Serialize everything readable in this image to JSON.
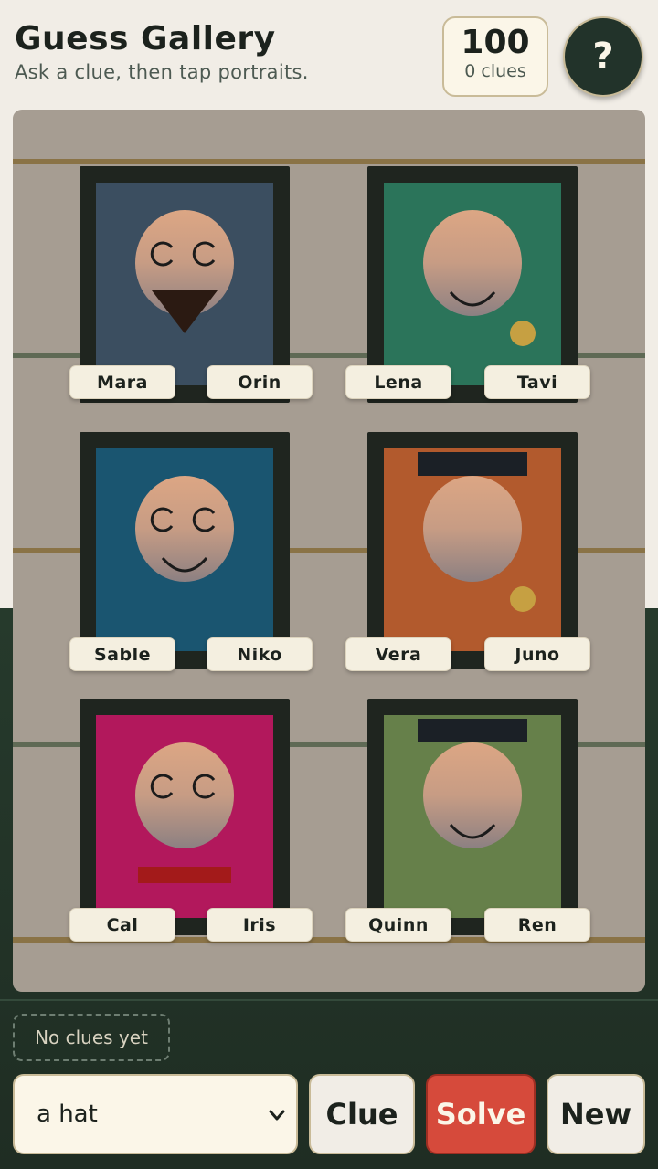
{
  "header": {
    "title": "Guess Gallery",
    "subtitle": "Ask a clue, then tap portraits.",
    "score": "100",
    "clues": "0 clues",
    "help_label": "?"
  },
  "portraits": [
    {
      "bg": "#3b4e60",
      "eyes": true,
      "mouth": false,
      "beard": true,
      "hat": false,
      "dot": false,
      "bar": false
    },
    {
      "bg": "#2b745a",
      "eyes": false,
      "mouth": true,
      "beard": false,
      "hat": false,
      "dot": true,
      "bar": false
    },
    {
      "bg": "#1a5570",
      "eyes": true,
      "mouth": true,
      "beard": false,
      "hat": false,
      "dot": false,
      "bar": false
    },
    {
      "bg": "#b25a2d",
      "eyes": false,
      "mouth": false,
      "beard": false,
      "hat": true,
      "dot": true,
      "bar": false
    },
    {
      "bg": "#b2185c",
      "eyes": true,
      "mouth": false,
      "beard": false,
      "hat": false,
      "dot": false,
      "bar": true
    },
    {
      "bg": "#66804a",
      "eyes": false,
      "mouth": true,
      "beard": false,
      "hat": true,
      "dot": false,
      "bar": false
    }
  ],
  "names": [
    "Mara",
    "Orin",
    "Lena",
    "Tavi",
    "Sable",
    "Niko",
    "Vera",
    "Juno",
    "Cal",
    "Iris",
    "Quinn",
    "Ren"
  ],
  "controls": {
    "clue_log": "No clues yet",
    "selected_clue": "a hat",
    "clue_button": "Clue",
    "solve_button": "Solve",
    "new_button": "New"
  },
  "colors": {
    "accent": "#d64a3b",
    "dark": "#22332a",
    "cream": "#fbf6e8"
  }
}
